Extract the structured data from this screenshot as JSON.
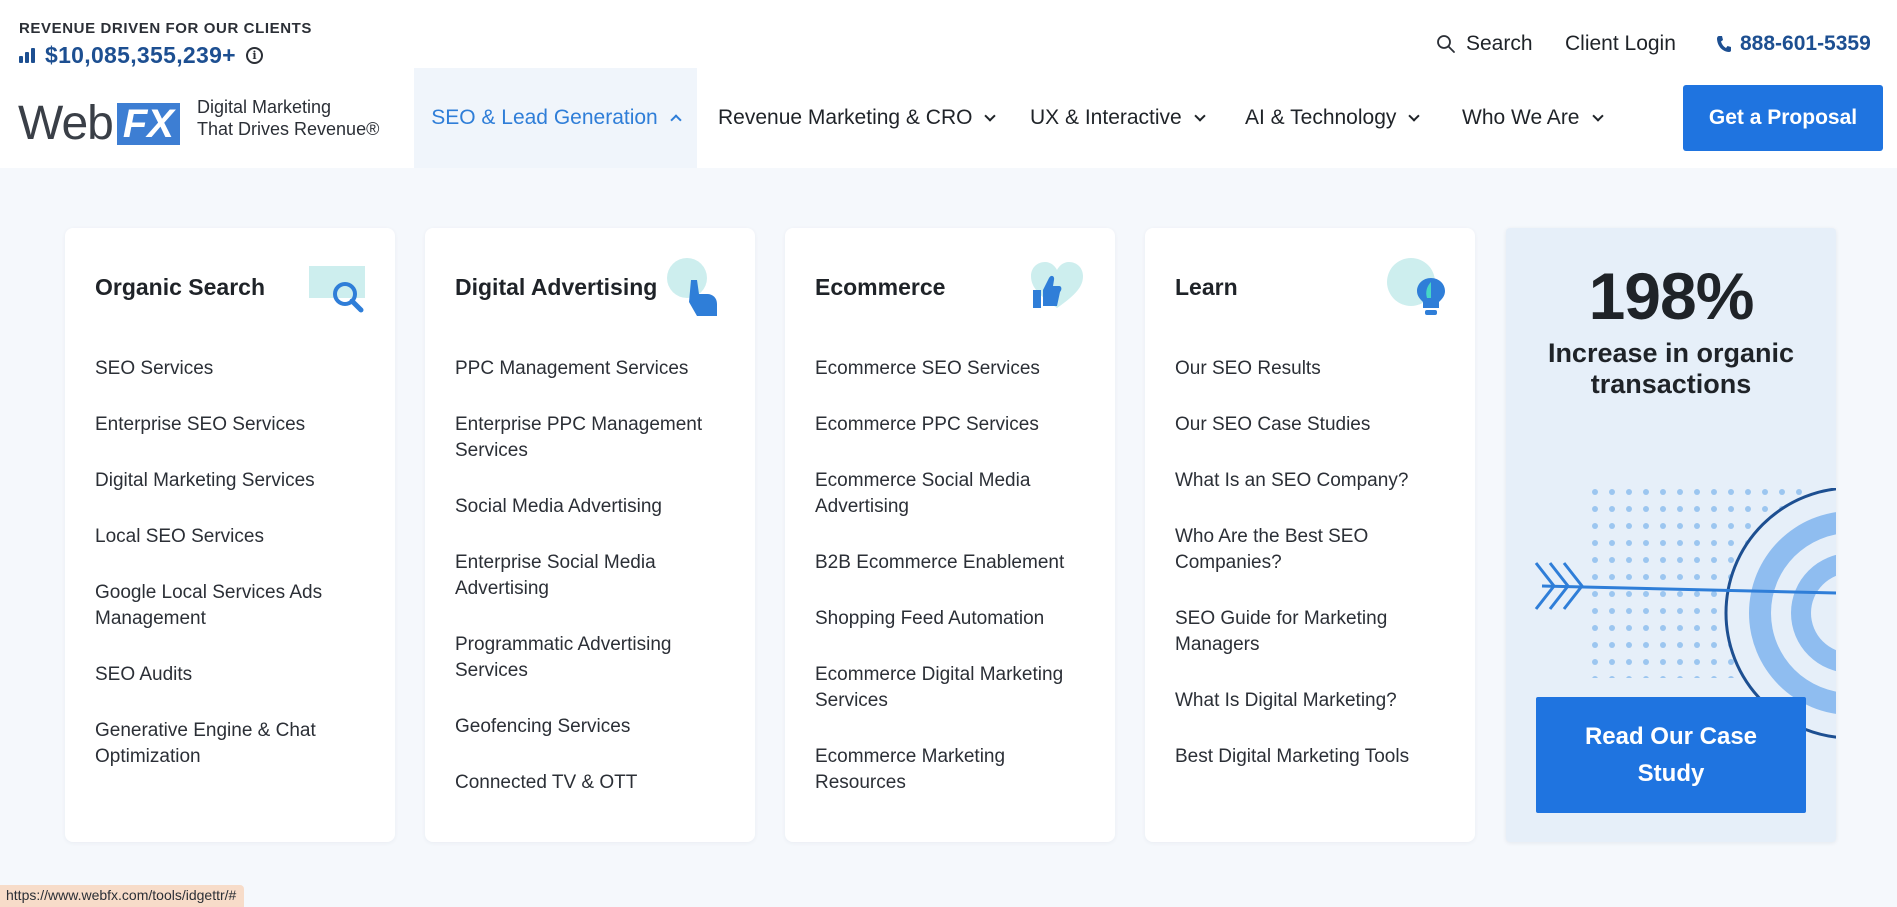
{
  "topbar": {
    "revenue_label": "REVENUE DRIVEN FOR OUR CLIENTS",
    "revenue_value": "$10,085,355,239+",
    "search_label": "Search",
    "login_label": "Client Login",
    "phone": "888-601-5359"
  },
  "logo": {
    "web": "Web",
    "fx": "FX",
    "tagline_line1": "Digital Marketing",
    "tagline_line2": "That Drives Revenue®"
  },
  "nav": {
    "items": [
      {
        "label": "SEO & Lead Generation",
        "active": true
      },
      {
        "label": "Revenue Marketing & CRO"
      },
      {
        "label": "UX & Interactive"
      },
      {
        "label": "AI & Technology"
      },
      {
        "label": "Who We Are"
      }
    ],
    "cta": "Get a Proposal"
  },
  "columns": [
    {
      "title": "Organic Search",
      "icon": "magnifier-icon",
      "links": [
        "SEO Services",
        "Enterprise SEO Services",
        "Digital Marketing Services",
        "Local SEO Services",
        "Google Local Services Ads Management",
        "SEO Audits",
        "Generative Engine & Chat Optimization"
      ]
    },
    {
      "title": "Digital Advertising",
      "icon": "pointer-hand-icon",
      "links": [
        "PPC Management Services",
        "Enterprise PPC Management Services",
        "Social Media Advertising",
        "Enterprise Social Media Advertising",
        "Programmatic Advertising Services",
        "Geofencing Services",
        "Connected TV & OTT"
      ]
    },
    {
      "title": "Ecommerce",
      "icon": "thumbs-up-heart-icon",
      "links": [
        "Ecommerce SEO Services",
        "Ecommerce PPC Services",
        "Ecommerce Social Media Advertising",
        "B2B Ecommerce Enablement",
        "Shopping Feed Automation",
        "Ecommerce Digital Marketing Services",
        "Ecommerce Marketing Resources"
      ]
    },
    {
      "title": "Learn",
      "icon": "lightbulb-icon",
      "links": [
        "Our SEO Results",
        "Our SEO Case Studies",
        "What Is an SEO Company?",
        "Who Are the Best SEO Companies?",
        "SEO Guide for Marketing Managers",
        "What Is Digital Marketing?",
        "Best Digital Marketing Tools"
      ]
    }
  ],
  "promo": {
    "stat": "198%",
    "text": "Increase in organic transactions",
    "button": "Read Our Case Study",
    "illustration": "target-arrow-icon"
  },
  "status_url": "https://www.webfx.com/tools/idgettr/#",
  "colors": {
    "brand_blue": "#1f74e0",
    "navy": "#1d4f91",
    "active_nav": "#2f7ed8",
    "page_bg": "#f5f8fc",
    "promo_bg": "#e6eff9"
  }
}
